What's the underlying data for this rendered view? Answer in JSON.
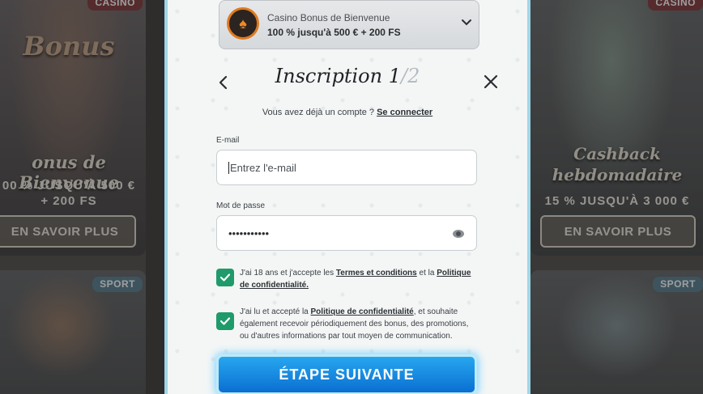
{
  "background": {
    "left_top": {
      "badge": "CASINO",
      "title": "onus de Bienvenue",
      "subtitle_line1": "00 % JUSQU'À 500 €",
      "subtitle_line2": "+ 200 FS",
      "button": "EN SAVOIR PLUS",
      "sign_text": "Bonus"
    },
    "left_bottom": {
      "badge": "SPORT"
    },
    "right_top": {
      "badge": "CASINO",
      "title_line1": "Cashback",
      "title_line2": "hebdomadaire",
      "subtitle": "15 % JUSQU'À 3 000 €",
      "button": "EN SAVOIR PLUS"
    },
    "right_bottom": {
      "badge": "SPORT"
    }
  },
  "bonus": {
    "title": "Casino Bonus de Bienvenue",
    "value": "100 % jusqu'à 500 € + 200 FS",
    "logo_icon": "card-suits-icon"
  },
  "header": {
    "title": "Inscription",
    "step_current": "1",
    "step_total": "/2"
  },
  "login_prompt": {
    "text": "Vous avez déjà un compte ?",
    "link": "Se connecter"
  },
  "form": {
    "email_label": "E-mail",
    "email_placeholder": "Entrez l'e-mail",
    "password_label": "Mot de passe",
    "password_value": "•••••••••••"
  },
  "consents": {
    "terms": {
      "prefix": "J'ai 18 ans et j'accepte les ",
      "link1": "Termes et conditions",
      "middle": " et la ",
      "link2": "Politique de confidentialité."
    },
    "marketing": {
      "prefix": "J'ai lu et accepté la ",
      "link": "Politique de confidentialité",
      "suffix": ", et souhaite également recevoir périodiquement des bonus, des promotions, ou d'autres informations par tout moyen de communication."
    }
  },
  "next_button": "ÉTAPE SUIVANTE",
  "colors": {
    "accent_blue": "#0a6fd1",
    "check_green": "#1f9a6b",
    "badge_casino": "#c9343a",
    "badge_sport": "#3d8fb8"
  }
}
